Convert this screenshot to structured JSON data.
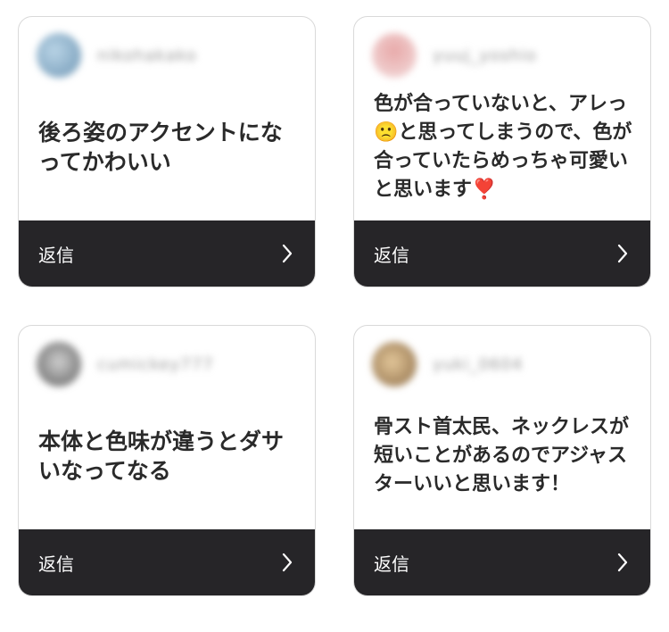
{
  "cards": [
    {
      "username": "nikohakako",
      "avatar_color": "#8fb3cc",
      "comment": "後ろ姿のアクセントになってかわいい",
      "reply_label": "返信",
      "chevron_icon": "chevron-right-icon"
    },
    {
      "username": "yuuj_yoshio",
      "avatar_color": "#d98c8c",
      "comment": "色が合っていないと、アレっ🙁と思ってしまうので、色が合っていたらめっちゃ可愛いと思います❣️",
      "reply_label": "返信",
      "chevron_icon": "chevron-right-icon"
    },
    {
      "username": "cumickey777",
      "avatar_color": "#7a7a7a",
      "comment": "本体と色味が違うとダサいなってなる",
      "reply_label": "返信",
      "chevron_icon": "chevron-right-icon"
    },
    {
      "username": "yuki_0604",
      "avatar_color": "#b89a6e",
      "comment": "骨スト首太民、ネックレスが短いことがあるのでアジャスターいいと思います！",
      "reply_label": "返信",
      "chevron_icon": "chevron-right-icon"
    }
  ],
  "colors": {
    "footer_bg": "#262528",
    "border": "#d9d9d9",
    "text": "#2a2a2a"
  }
}
